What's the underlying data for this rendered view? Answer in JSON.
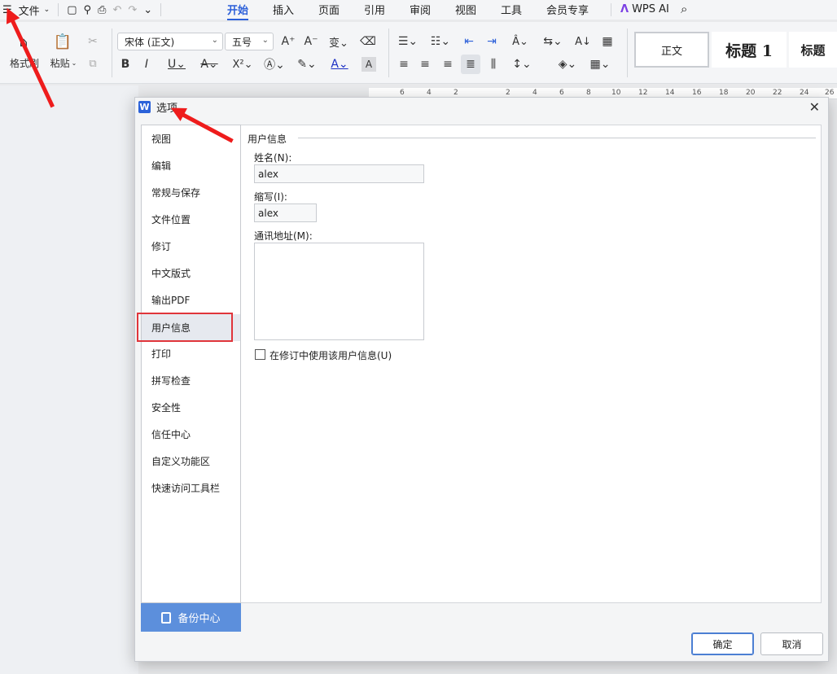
{
  "menubar": {
    "file_label": "文件",
    "tabs": [
      "开始",
      "插入",
      "页面",
      "引用",
      "审阅",
      "视图",
      "工具",
      "会员专享"
    ],
    "wps_ai_label": "WPS AI"
  },
  "ribbon": {
    "format_painter_label": "格式刷",
    "paste_label": "粘贴",
    "font_name": "宋体 (正文)",
    "font_size": "五号",
    "styles": [
      "正文",
      "标题 1",
      "标题"
    ]
  },
  "ruler": {
    "ticks": [
      "6",
      "4",
      "2",
      "2",
      "4",
      "6",
      "8",
      "10",
      "12",
      "14",
      "16",
      "18",
      "20",
      "22",
      "24",
      "26"
    ]
  },
  "dialog": {
    "title": "选项",
    "nav_items": [
      "视图",
      "编辑",
      "常规与保存",
      "文件位置",
      "修订",
      "中文版式",
      "输出PDF",
      "用户信息",
      "打印",
      "拼写检查",
      "安全性",
      "信任中心",
      "自定义功能区",
      "快速访问工具栏"
    ],
    "selected_nav": "用户信息",
    "backup_label": "备份中心",
    "section_title": "用户信息",
    "name_label": "姓名(N):",
    "name_value": "alex",
    "initials_label": "缩写(I):",
    "initials_value": "alex",
    "address_label": "通讯地址(M):",
    "address_value": "",
    "use_info_label": "在修订中使用该用户信息(U)",
    "use_info_checked": false,
    "ok_label": "确定",
    "cancel_label": "取消"
  }
}
